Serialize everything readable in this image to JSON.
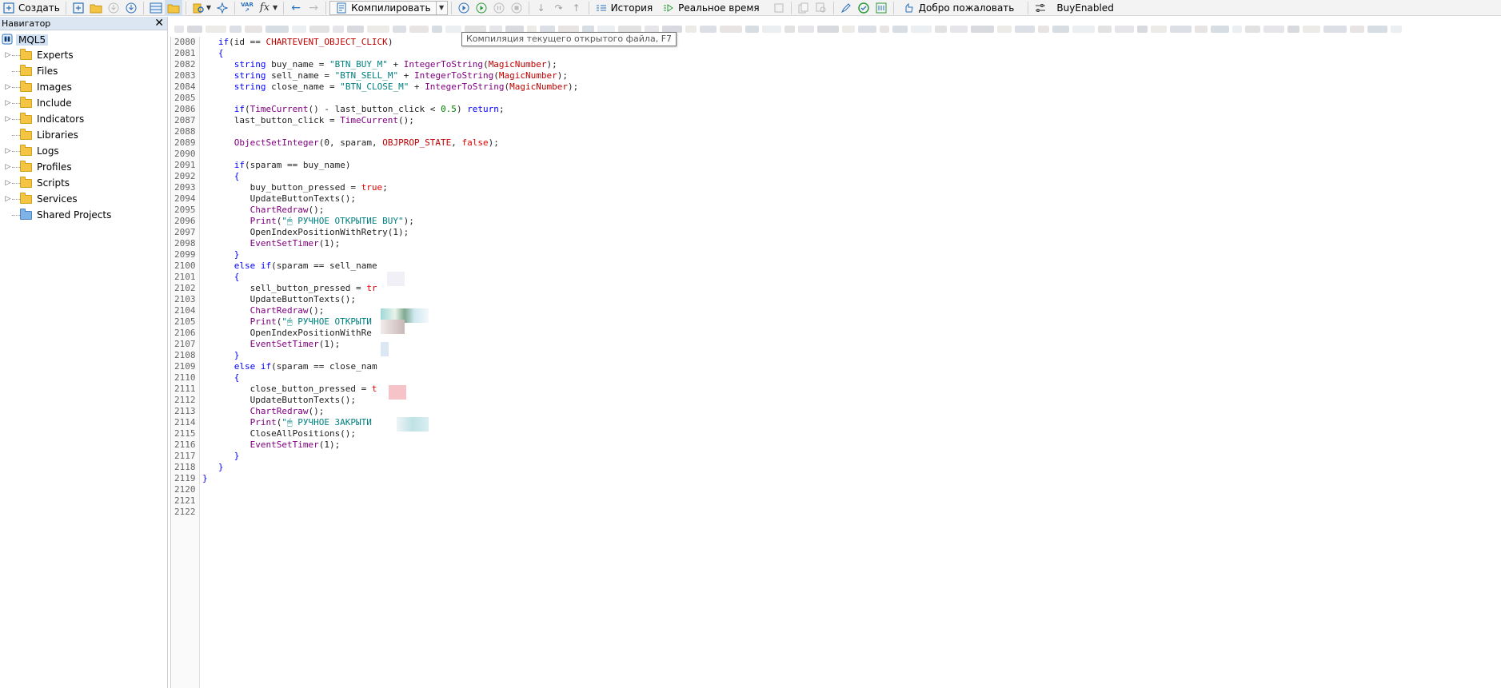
{
  "toolbar": {
    "create_label": "Создать",
    "compile_label": "Компилировать",
    "history_label": "История",
    "realtime_label": "Реальное время",
    "welcome_label": "Добро пожаловать",
    "search_value": "BuyEnabled",
    "var_label": "VAR",
    "fx_label": "fx"
  },
  "tooltip": {
    "text": "Компиляция текущего открытого файла, F7"
  },
  "navigator": {
    "title": "Навигатор",
    "root": "MQL5",
    "items": [
      {
        "label": "Experts",
        "expandable": true
      },
      {
        "label": "Files",
        "expandable": false
      },
      {
        "label": "Images",
        "expandable": true
      },
      {
        "label": "Include",
        "expandable": true
      },
      {
        "label": "Indicators",
        "expandable": true
      },
      {
        "label": "Libraries",
        "expandable": false
      },
      {
        "label": "Logs",
        "expandable": true
      },
      {
        "label": "Profiles",
        "expandable": true
      },
      {
        "label": "Scripts",
        "expandable": true
      },
      {
        "label": "Services",
        "expandable": true
      },
      {
        "label": "Shared Projects",
        "expandable": false,
        "color": "blue"
      }
    ]
  },
  "editor": {
    "lines": [
      {
        "n": "2080",
        "tokens": [
          [
            "   ",
            "id"
          ],
          [
            "if",
            "blue"
          ],
          [
            "(id == ",
            "id"
          ],
          [
            "CHARTEVENT_OBJECT_CLICK",
            "const"
          ],
          [
            ")",
            "id"
          ]
        ]
      },
      {
        "n": "2081",
        "tokens": [
          [
            "   {",
            "blue"
          ]
        ]
      },
      {
        "n": "2082",
        "tokens": [
          [
            "      ",
            "id"
          ],
          [
            "string",
            "type"
          ],
          [
            " buy_name = ",
            "id"
          ],
          [
            "\"BTN_BUY_M\"",
            "str"
          ],
          [
            " + ",
            "id"
          ],
          [
            "IntegerToString",
            "fn"
          ],
          [
            "(",
            "id"
          ],
          [
            "MagicNumber",
            "const"
          ],
          [
            ");",
            "id"
          ]
        ]
      },
      {
        "n": "2083",
        "tokens": [
          [
            "      ",
            "id"
          ],
          [
            "string",
            "type"
          ],
          [
            " sell_name = ",
            "id"
          ],
          [
            "\"BTN_SELL_M\"",
            "str"
          ],
          [
            " + ",
            "id"
          ],
          [
            "IntegerToString",
            "fn"
          ],
          [
            "(",
            "id"
          ],
          [
            "MagicNumber",
            "const"
          ],
          [
            ");",
            "id"
          ]
        ]
      },
      {
        "n": "2084",
        "tokens": [
          [
            "      ",
            "id"
          ],
          [
            "string",
            "type"
          ],
          [
            " close_name = ",
            "id"
          ],
          [
            "\"BTN_CLOSE_M\"",
            "str"
          ],
          [
            " + ",
            "id"
          ],
          [
            "IntegerToString",
            "fn"
          ],
          [
            "(",
            "id"
          ],
          [
            "MagicNumber",
            "const"
          ],
          [
            ");",
            "id"
          ]
        ]
      },
      {
        "n": "2085",
        "tokens": []
      },
      {
        "n": "2086",
        "tokens": [
          [
            "      ",
            "id"
          ],
          [
            "if",
            "blue"
          ],
          [
            "(",
            "id"
          ],
          [
            "TimeCurrent",
            "fn"
          ],
          [
            "() - last_button_click < ",
            "id"
          ],
          [
            "0.5",
            "num"
          ],
          [
            ") ",
            "id"
          ],
          [
            "return",
            "blue"
          ],
          [
            ";",
            "id"
          ]
        ]
      },
      {
        "n": "2087",
        "tokens": [
          [
            "      last_button_click = ",
            "id"
          ],
          [
            "TimeCurrent",
            "fn"
          ],
          [
            "();",
            "id"
          ]
        ]
      },
      {
        "n": "2088",
        "tokens": []
      },
      {
        "n": "2089",
        "tokens": [
          [
            "      ",
            "id"
          ],
          [
            "ObjectSetInteger",
            "fn"
          ],
          [
            "(0, sparam, ",
            "id"
          ],
          [
            "OBJPROP_STATE",
            "const"
          ],
          [
            ", ",
            "id"
          ],
          [
            "false",
            "red"
          ],
          [
            ");",
            "id"
          ]
        ]
      },
      {
        "n": "2090",
        "tokens": []
      },
      {
        "n": "2091",
        "tokens": [
          [
            "      ",
            "id"
          ],
          [
            "if",
            "blue"
          ],
          [
            "(sparam == buy_name)",
            "id"
          ]
        ]
      },
      {
        "n": "2092",
        "tokens": [
          [
            "      {",
            "blue"
          ]
        ]
      },
      {
        "n": "2093",
        "tokens": [
          [
            "         buy_button_pressed = ",
            "id"
          ],
          [
            "true",
            "red"
          ],
          [
            ";",
            "id"
          ]
        ]
      },
      {
        "n": "2094",
        "tokens": [
          [
            "         UpdateButtonTexts();",
            "id"
          ]
        ]
      },
      {
        "n": "2095",
        "tokens": [
          [
            "         ",
            "id"
          ],
          [
            "ChartRedraw",
            "fn"
          ],
          [
            "();",
            "id"
          ]
        ]
      },
      {
        "n": "2096",
        "tokens": [
          [
            "         ",
            "id"
          ],
          [
            "Print",
            "fn"
          ],
          [
            "(",
            "id"
          ],
          [
            "\"🖱 РУЧНОЕ ОТКРЫТИЕ BUY\"",
            "str"
          ],
          [
            ");",
            "id"
          ]
        ]
      },
      {
        "n": "2097",
        "tokens": [
          [
            "         OpenIndexPositionWithRetry(1);",
            "id"
          ]
        ]
      },
      {
        "n": "2098",
        "tokens": [
          [
            "         ",
            "id"
          ],
          [
            "EventSetTimer",
            "fn"
          ],
          [
            "(1);",
            "id"
          ]
        ]
      },
      {
        "n": "2099",
        "tokens": [
          [
            "      }",
            "blue"
          ]
        ]
      },
      {
        "n": "2100",
        "tokens": [
          [
            "      ",
            "id"
          ],
          [
            "else if",
            "blue"
          ],
          [
            "(sparam == sell_name",
            "id"
          ]
        ]
      },
      {
        "n": "2101",
        "tokens": [
          [
            "      {",
            "blue"
          ]
        ]
      },
      {
        "n": "2102",
        "tokens": [
          [
            "         sell_button_pressed = ",
            "id"
          ],
          [
            "tr",
            "red"
          ]
        ]
      },
      {
        "n": "2103",
        "tokens": [
          [
            "         UpdateButtonTexts();",
            "id"
          ]
        ]
      },
      {
        "n": "2104",
        "tokens": [
          [
            "         ",
            "id"
          ],
          [
            "ChartRedraw",
            "fn"
          ],
          [
            "();",
            "id"
          ]
        ]
      },
      {
        "n": "2105",
        "tokens": [
          [
            "         ",
            "id"
          ],
          [
            "Print",
            "fn"
          ],
          [
            "(",
            "id"
          ],
          [
            "\"🖱 РУЧНОЕ ОТКРЫТИ",
            "str"
          ]
        ]
      },
      {
        "n": "2106",
        "tokens": [
          [
            "         OpenIndexPositionWithRe",
            "id"
          ]
        ]
      },
      {
        "n": "2107",
        "tokens": [
          [
            "         ",
            "id"
          ],
          [
            "EventSetTimer",
            "fn"
          ],
          [
            "(1);",
            "id"
          ]
        ]
      },
      {
        "n": "2108",
        "tokens": [
          [
            "      }",
            "blue"
          ]
        ]
      },
      {
        "n": "2109",
        "tokens": [
          [
            "      ",
            "id"
          ],
          [
            "else if",
            "blue"
          ],
          [
            "(sparam == close_nam",
            "id"
          ]
        ]
      },
      {
        "n": "2110",
        "tokens": [
          [
            "      {",
            "blue"
          ]
        ]
      },
      {
        "n": "2111",
        "tokens": [
          [
            "         close_button_pressed = ",
            "id"
          ],
          [
            "t",
            "red"
          ]
        ]
      },
      {
        "n": "2112",
        "tokens": [
          [
            "         UpdateButtonTexts();",
            "id"
          ]
        ]
      },
      {
        "n": "2113",
        "tokens": [
          [
            "         ",
            "id"
          ],
          [
            "ChartRedraw",
            "fn"
          ],
          [
            "();",
            "id"
          ]
        ]
      },
      {
        "n": "2114",
        "tokens": [
          [
            "         ",
            "id"
          ],
          [
            "Print",
            "fn"
          ],
          [
            "(",
            "id"
          ],
          [
            "\"🖱 РУЧНОЕ ЗАКРЫТИ",
            "str"
          ]
        ]
      },
      {
        "n": "2115",
        "tokens": [
          [
            "         CloseAllPositions();",
            "id"
          ]
        ]
      },
      {
        "n": "2116",
        "tokens": [
          [
            "         ",
            "id"
          ],
          [
            "EventSetTimer",
            "fn"
          ],
          [
            "(1);",
            "id"
          ]
        ]
      },
      {
        "n": "2117",
        "tokens": [
          [
            "      }",
            "blue"
          ]
        ]
      },
      {
        "n": "2118",
        "tokens": [
          [
            "   }",
            "blue"
          ]
        ]
      },
      {
        "n": "2119",
        "tokens": [
          [
            "}",
            "blue"
          ]
        ]
      },
      {
        "n": "2120",
        "tokens": []
      },
      {
        "n": "2121",
        "tokens": []
      },
      {
        "n": "2122",
        "tokens": []
      }
    ]
  },
  "colors": {
    "keyword": "#0000ff",
    "string": "#008080",
    "function": "#800080",
    "constant": "#c00000",
    "literal": "#e00000",
    "number": "#008000"
  }
}
